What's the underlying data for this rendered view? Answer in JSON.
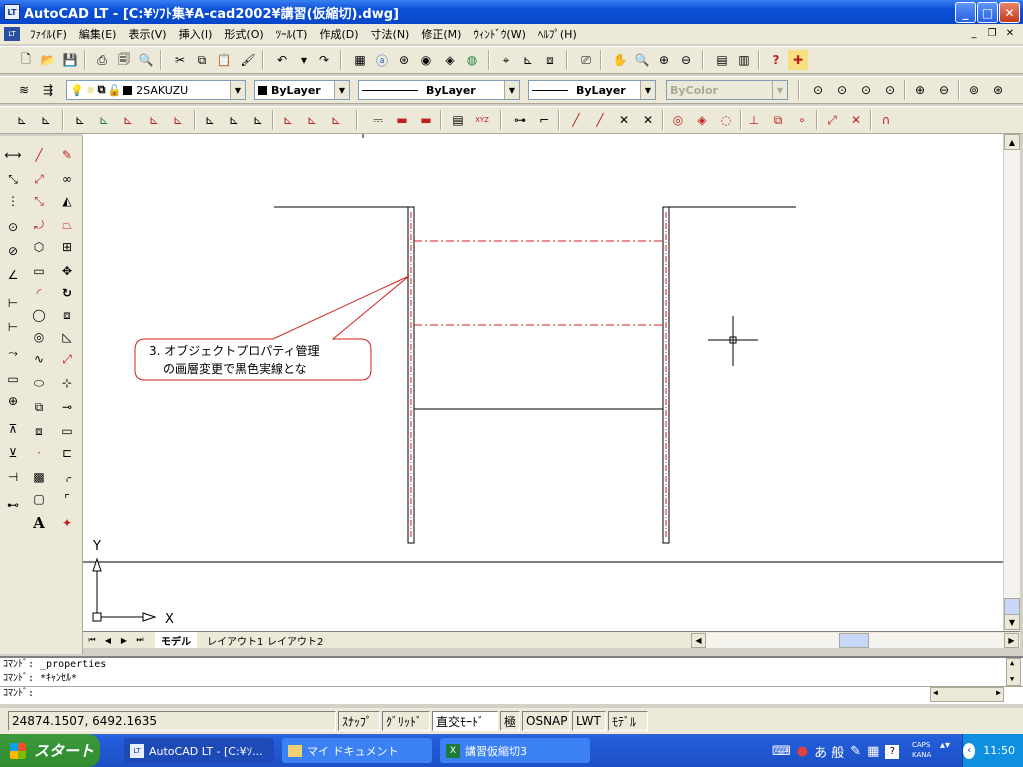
{
  "window": {
    "title": "AutoCAD LT - [C:¥ｿﾌﾄ集¥A-cad2002¥講習(仮縮切).dwg]",
    "app_icon": "LT"
  },
  "menu": [
    "ﾌｧｲﾙ(F)",
    "編集(E)",
    "表示(V)",
    "挿入(I)",
    "形式(O)",
    "ﾂｰﾙ(T)",
    "作成(D)",
    "寸法(N)",
    "修正(M)",
    "ｳｨﾝﾄﾞｳ(W)",
    "ﾍﾙﾌﾟ(H)"
  ],
  "layers": {
    "layer_name": "2SAKUZU",
    "color": "ByLayer",
    "linetype": "ByLayer",
    "lineweight": "ByLayer",
    "plotstyle": "ByColor"
  },
  "callout": {
    "line1": "3. オブジェクトプロパティ管理",
    "line2": "の画層変更で黒色実線とな"
  },
  "ucs": {
    "x": "X",
    "y": "Y"
  },
  "tabs": [
    "モデル",
    "レイアウト1",
    "レイアウト2"
  ],
  "command": {
    "line1": "ｺﾏﾝﾄﾞ: _properties",
    "line2": "ｺﾏﾝﾄﾞ: *ｷｬﾝｾﾙ*",
    "prompt": "ｺﾏﾝﾄﾞ:"
  },
  "status": {
    "coords": "24874.1507, 6492.1635",
    "snap": "ｽﾅｯﾌﾟ",
    "grid": "ｸﾞﾘｯﾄﾞ",
    "ortho": "直交ﾓｰﾄﾞ",
    "polar": "極",
    "osnap": "OSNAP",
    "lwt": "LWT",
    "model": "ﾓﾃﾞﾙ"
  },
  "taskbar": {
    "start": "スタート",
    "tasks": [
      "AutoCAD LT - [C:¥ｿ...",
      "マイ ドキュメント",
      "講習仮縮切3"
    ],
    "ime": "あ 般",
    "caps": "CAPS",
    "kana": "KANA",
    "time": "11:50"
  }
}
